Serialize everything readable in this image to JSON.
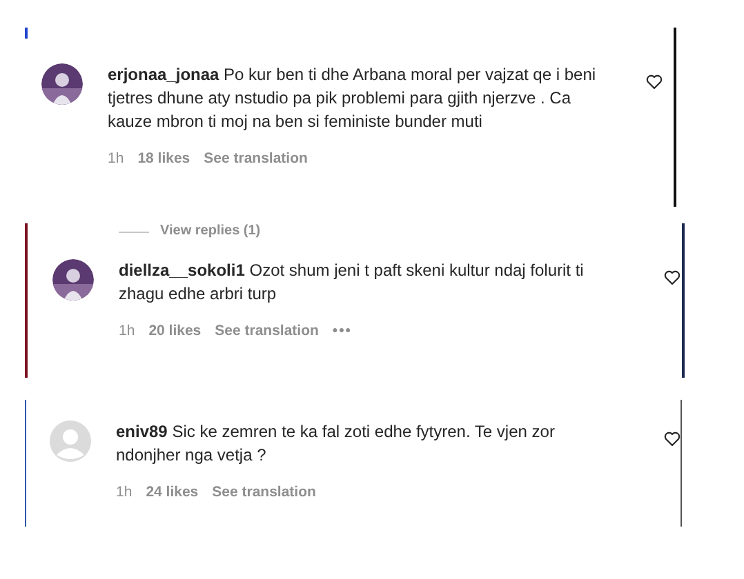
{
  "comments": [
    {
      "username": "erjonaa_jonaa",
      "text": "Po kur ben ti dhe Arbana moral per vajzat qe i beni tjetres dhune aty nstudio pa pik problemi para gjith njerzve . Ca kauze mbron ti moj na ben si feministe bunder muti",
      "time": "1h",
      "likes": "18 likes",
      "translation": "See translation",
      "kind": "picture"
    },
    {
      "view_replies": "View replies (1)",
      "username": "diellza__sokoli1",
      "text": "Ozot shum jeni t paft skeni kultur ndaj folurit ti zhagu edhe arbri turp",
      "time": "1h",
      "likes": "20 likes",
      "translation": "See translation",
      "more": "•••",
      "kind": "picture"
    },
    {
      "username": "eniv89",
      "text": "Sic ke zemren te ka fal zoti edhe fytyren. Te vjen zor ndonjher nga vetja ?",
      "time": "1h",
      "likes": "24 likes",
      "translation": "See translation",
      "kind": "avatar"
    }
  ]
}
